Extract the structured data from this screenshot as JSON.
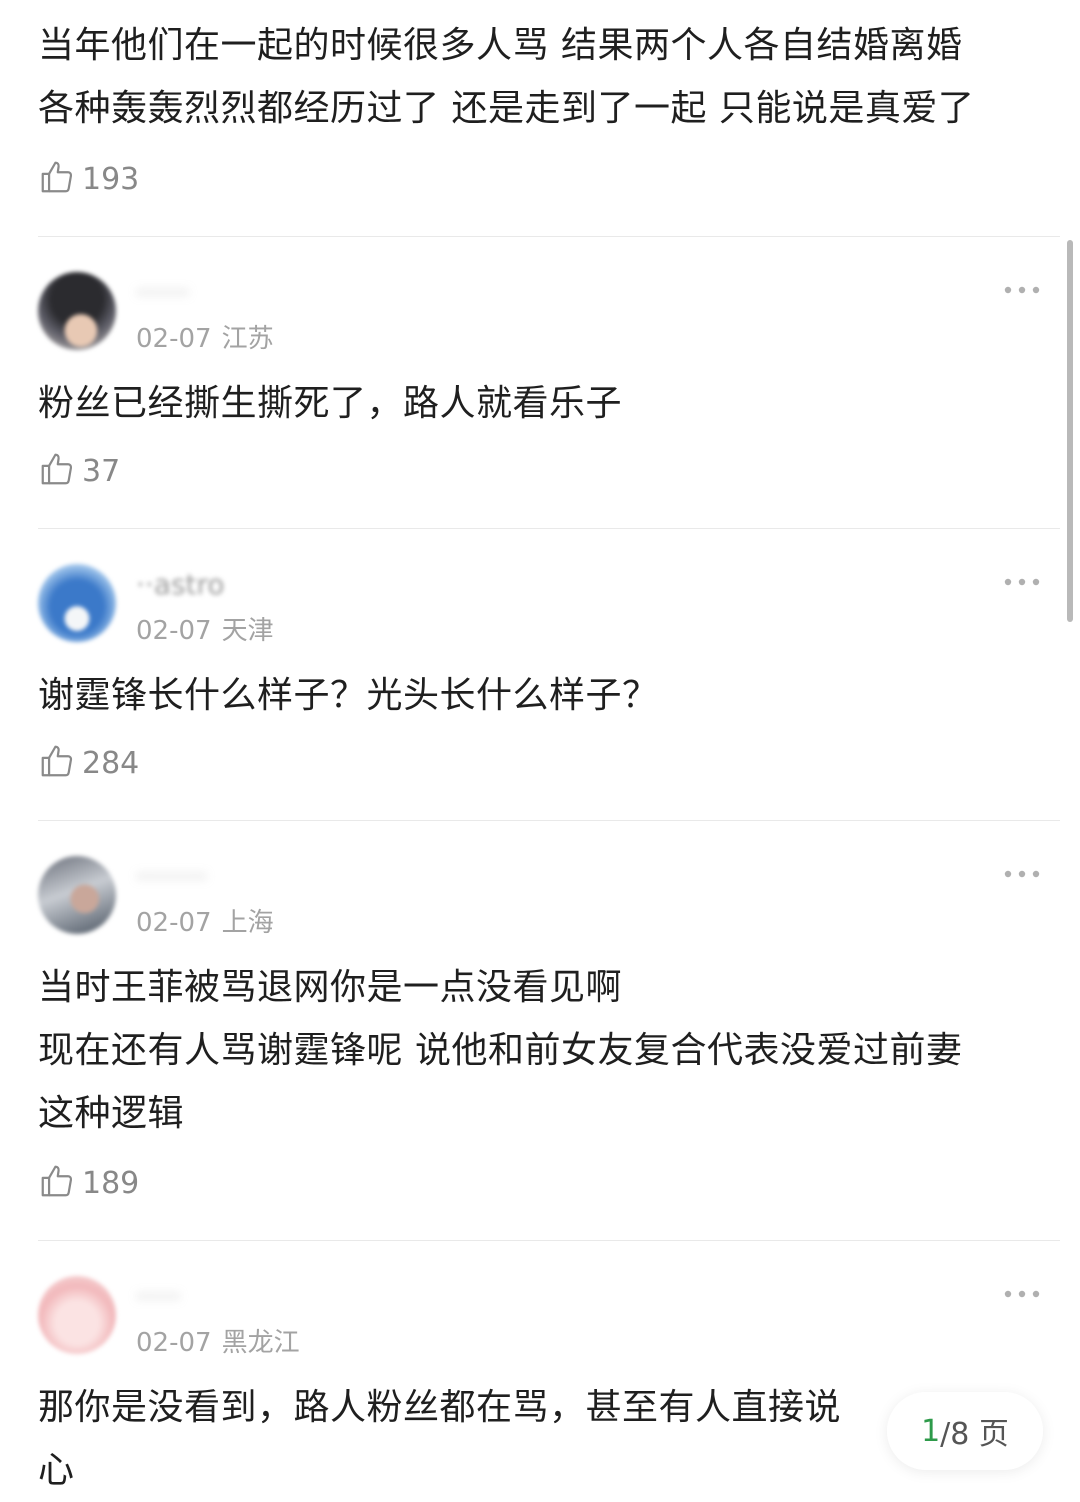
{
  "first_comment": {
    "lines": [
      "当年他们在一起的时候很多人骂 结果两个人各自结婚离婚",
      "各种轰轰烈烈都经历过了 还是走到了一起 只能说是真爱了"
    ],
    "likes": "193"
  },
  "comments": [
    {
      "username": "······",
      "date": "02-07",
      "location": "江苏",
      "lines": [
        "粉丝已经撕生撕死了，路人就看乐子"
      ],
      "likes": "37"
    },
    {
      "username": "··astro",
      "date": "02-07",
      "location": "天津",
      "lines": [
        "谢霆锋长什么样子？光头长什么样子？"
      ],
      "likes": "284"
    },
    {
      "username": "········",
      "date": "02-07",
      "location": "上海",
      "lines": [
        "当时王菲被骂退网你是一点没看见啊",
        "现在还有人骂谢霆锋呢 说他和前女友复合代表没爱过前妻",
        "这种逻辑"
      ],
      "likes": "189"
    },
    {
      "username": "·····",
      "date": "02-07",
      "location": "黑龙江",
      "lines": [
        "那你是没看到，路人粉丝都在骂，甚至有人直接说",
        "心"
      ],
      "likes": ""
    }
  ],
  "pager": {
    "current": "1",
    "total_label": "/8 页"
  },
  "icons": {
    "like": "thumbs-up-icon",
    "more": "more-dots-icon"
  },
  "colors": {
    "text": "#1f1f1f",
    "meta": "#a3a3a3",
    "pager_current": "#2e9a4a"
  }
}
